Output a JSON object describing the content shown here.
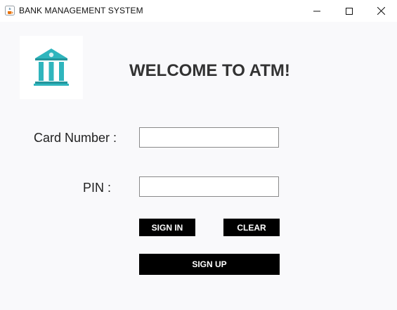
{
  "window": {
    "title": "BANK MANAGEMENT SYSTEM",
    "icon": "java-cup-icon",
    "controls": [
      "minimize",
      "maximize",
      "close"
    ]
  },
  "header": {
    "logo_icon": "bank-building-icon",
    "welcome_text": "WELCOME TO ATM!"
  },
  "form": {
    "card_label": "Card Number :",
    "card_value": "",
    "pin_label": "PIN :",
    "pin_value": ""
  },
  "buttons": {
    "sign_in": "SIGN IN",
    "clear": "CLEAR",
    "sign_up": "SIGN UP"
  },
  "colors": {
    "logo": "#2fb5bd",
    "button_bg": "#000000",
    "button_text": "#ffffff",
    "welcome_text": "#333333"
  }
}
